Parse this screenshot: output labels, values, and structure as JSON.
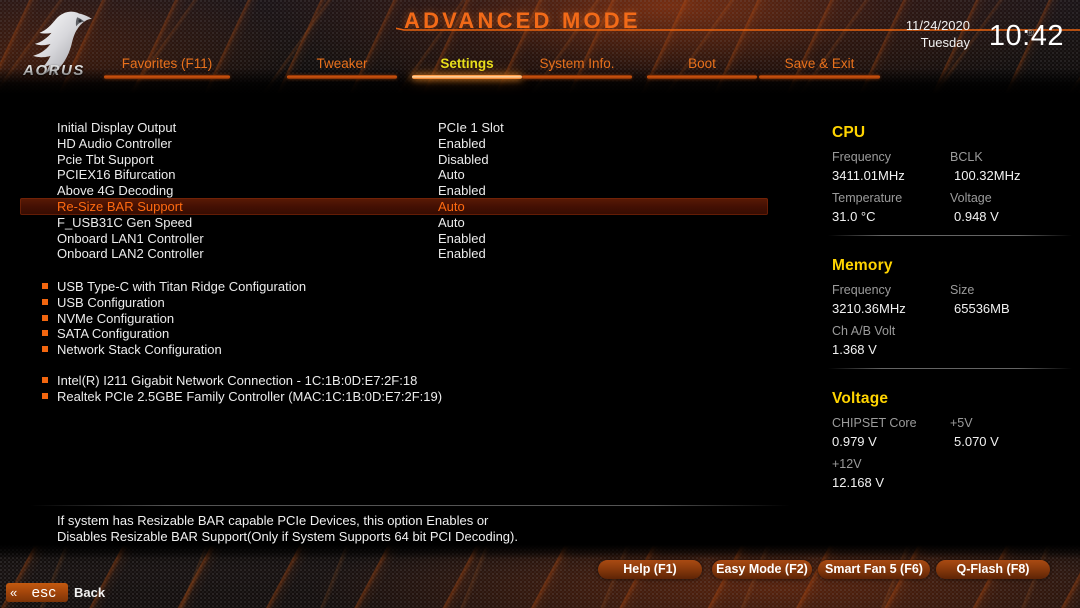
{
  "header": {
    "brand": "AORUS",
    "mode_title": "ADVANCED MODE",
    "registered_mark": "®",
    "clock": {
      "date": "11/24/2020",
      "day": "Tuesday",
      "time": "10:42"
    },
    "accent_color": "#f2660f",
    "active_tab_color": "#e8e11c"
  },
  "tabs": [
    {
      "label": "Favorites (F11)",
      "active": false
    },
    {
      "label": "Tweaker",
      "active": false
    },
    {
      "label": "Settings",
      "active": true
    },
    {
      "label": "System Info.",
      "active": false
    },
    {
      "label": "Boot",
      "active": false
    },
    {
      "label": "Save & Exit",
      "active": false
    }
  ],
  "options": [
    {
      "name": "Initial Display Output",
      "value": "PCIe 1 Slot",
      "selected": false
    },
    {
      "name": "HD Audio Controller",
      "value": "Enabled",
      "selected": false
    },
    {
      "name": "Pcie Tbt Support",
      "value": "Disabled",
      "selected": false
    },
    {
      "name": "PCIEX16 Bifurcation",
      "value": "Auto",
      "selected": false
    },
    {
      "name": "Above 4G Decoding",
      "value": "Enabled",
      "selected": false
    },
    {
      "name": "Re-Size BAR Support",
      "value": "Auto",
      "selected": true
    },
    {
      "name": "F_USB31C Gen Speed",
      "value": "Auto",
      "selected": false
    },
    {
      "name": "Onboard LAN1 Controller",
      "value": "Enabled",
      "selected": false
    },
    {
      "name": "Onboard LAN2 Controller",
      "value": "Enabled",
      "selected": false
    }
  ],
  "submenus_group1": [
    {
      "label": "USB Type-C with Titan Ridge Configuration"
    },
    {
      "label": "USB Configuration"
    },
    {
      "label": "NVMe Configuration"
    },
    {
      "label": "SATA Configuration"
    },
    {
      "label": "Network Stack Configuration"
    }
  ],
  "submenus_group2": [
    {
      "label": "Intel(R) I211 Gigabit  Network Connection - 1C:1B:0D:E7:2F:18"
    },
    {
      "label": "Realtek PCIe 2.5GBE Family Controller (MAC:1C:1B:0D:E7:2F:19)"
    }
  ],
  "sidebar": {
    "sections": [
      {
        "title": "CPU",
        "fields": [
          {
            "key": "Frequency",
            "value": "3411.01MHz"
          },
          {
            "key": "BCLK",
            "value": "100.32MHz"
          },
          {
            "key": "Temperature",
            "value": "31.0 °C"
          },
          {
            "key": "Voltage",
            "value": "0.948 V"
          }
        ]
      },
      {
        "title": "Memory",
        "fields": [
          {
            "key": "Frequency",
            "value": "3210.36MHz"
          },
          {
            "key": "Size",
            "value": "65536MB"
          },
          {
            "key": "Ch A/B Volt",
            "value": "1.368 V"
          }
        ]
      },
      {
        "title": "Voltage",
        "fields": [
          {
            "key": "CHIPSET Core",
            "value": "0.979 V"
          },
          {
            "key": "+5V",
            "value": "5.070 V"
          },
          {
            "key": "+12V",
            "value": "12.168 V"
          }
        ]
      }
    ]
  },
  "help": {
    "line1": "If system has Resizable BAR capable PCIe Devices, this option Enables or",
    "line2": "Disables Resizable BAR Support(Only if System Supports 64 bit PCI Decoding)."
  },
  "footer": {
    "function_keys": [
      {
        "label": "Help (F1)"
      },
      {
        "label": "Easy Mode (F2)"
      },
      {
        "label": "Smart Fan 5 (F6)"
      },
      {
        "label": "Q-Flash (F8)"
      }
    ],
    "esc_key": "esc",
    "esc_chevron": "«",
    "back_label": "Back"
  }
}
